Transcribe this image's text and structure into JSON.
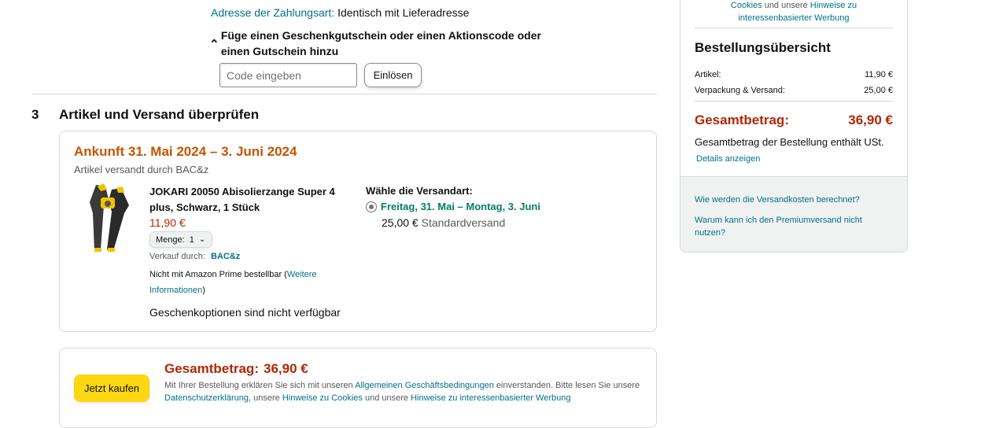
{
  "payment": {
    "address_label": "Adresse der Zahlungsart:",
    "address_value": "Identisch mit Lieferadresse"
  },
  "voucher": {
    "toggle_label": "Füge einen Geschenkgutschein oder einen Aktionscode oder einen Gutschein hinzu",
    "input_placeholder": "Code eingeben",
    "redeem_label": "Einlösen"
  },
  "step3": {
    "number": "3",
    "title": "Artikel und Versand überprüfen"
  },
  "delivery": {
    "arrival": "Ankunft 31. Mai 2024 – 3. Juni 2024",
    "shipped_by": "Artikel versandt durch BAC&z",
    "product": {
      "title": "JOKARI 20050 Abisolierzange Super 4 plus, Schwarz, 1 Stück",
      "price": "11,90 €",
      "quantity_label": "Menge:",
      "quantity_value": "1",
      "sold_by_label": "Verkauf durch:",
      "seller": "BAC&z",
      "prime_note_prefix": "Nicht mit Amazon Prime bestellbar (",
      "prime_note_link": "Weitere Informationen",
      "prime_note_suffix": ")",
      "gift_options": "Geschenkoptionen sind nicht verfügbar",
      "image_icon": "wire-stripper-product-image"
    },
    "shipping": {
      "heading": "Wähle die Versandart:",
      "option_label": "Freitag, 31. Mai – Montag, 3. Juni",
      "option_price": "25,00 €",
      "option_desc": "Standardversand"
    }
  },
  "order": {
    "buy_button": "Jetzt kaufen",
    "total_label": "Gesamtbetrag:",
    "total_value": "36,90 €",
    "legal_1": "Mit Ihrer Bestellung erklären Sie sich mit unseren ",
    "legal_link_agb": "Allgemeinen Geschäftsbedingungen",
    "legal_2": " einverstanden. Bitte lesen Sie unsere ",
    "legal_link_privacy": "Datenschutzerklärung",
    "legal_3": ", unsere ",
    "legal_link_cookies": "Hinweise zu Cookies",
    "legal_4": " und unsere ",
    "legal_link_ads": "Hinweise zu interessenbasierter Werbung"
  },
  "summary": {
    "top_cookies_link": "Cookies",
    "top_and": " und unsere ",
    "top_hints_link": "Hinweise zu",
    "top_ads_link": "interessenbasierter Werbung",
    "heading": "Bestellungsübersicht",
    "items_label": "Artikel:",
    "items_value": "11,90 €",
    "shipping_label": "Verpackung & Versand:",
    "shipping_value": "25,00 €",
    "total_label": "Gesamtbetrag:",
    "total_value": "36,90 €",
    "vat_note": "Gesamtbetrag der Bestellung enthält USt.",
    "vat_link": "Details anzeigen",
    "faq_shipping_cost": "Wie werden die Versandkosten berechnet?",
    "faq_premium": "Warum kann ich den Premiumversand nicht nutzen?"
  },
  "colors": {
    "link": "#007185",
    "price": "#b12704",
    "arrival": "#c45500",
    "shipping_option": "#067d62",
    "buy_button": "#ffd814",
    "accent_tool": "#f0c300"
  }
}
